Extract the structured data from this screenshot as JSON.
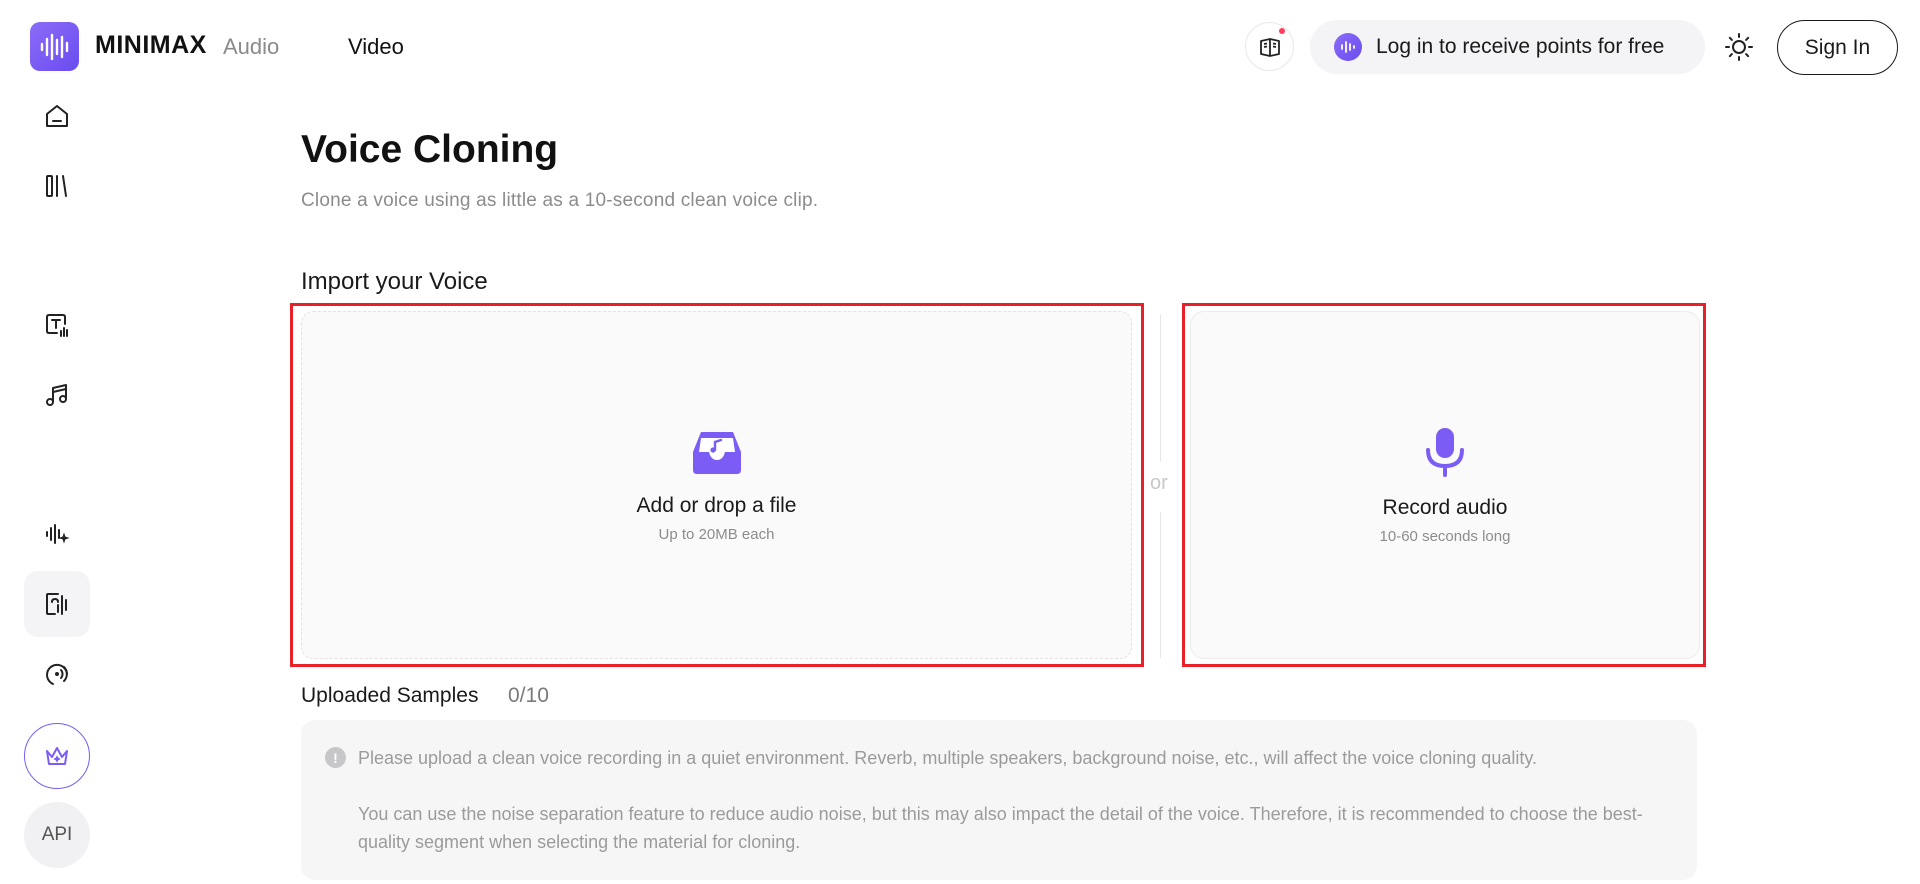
{
  "header": {
    "brand": "MINIMAX",
    "nav": {
      "audio": "Audio",
      "video": "Video"
    },
    "points_cta": "Log in to receive points for free",
    "sign_in": "Sign In",
    "icons": {
      "logo": "waveform-logo-icon",
      "guide": "book-icon",
      "theme": "sun-icon"
    }
  },
  "sidebar": {
    "items": [
      {
        "name": "home",
        "icon": "home-icon"
      },
      {
        "name": "library",
        "icon": "library-icon"
      },
      {
        "name": "text-to-speech",
        "icon": "text-speech-icon"
      },
      {
        "name": "music",
        "icon": "music-icon"
      },
      {
        "name": "voice-design",
        "icon": "sparkle-wave-icon"
      },
      {
        "name": "voice-cloning",
        "icon": "voice-clone-icon",
        "active": true
      },
      {
        "name": "voice-isolation",
        "icon": "broadcast-icon"
      },
      {
        "name": "subscription",
        "icon": "crown-icon"
      }
    ],
    "api_label": "API"
  },
  "main": {
    "title": "Voice Cloning",
    "subtitle": "Clone a voice using as little as a 10-second clean voice clip.",
    "import_label": "Import your Voice",
    "upload": {
      "title": "Add or drop a file",
      "subtitle": "Up to 20MB each",
      "icon": "inbox-music-icon"
    },
    "divider": "or",
    "record": {
      "title": "Record audio",
      "subtitle": "10-60 seconds long",
      "icon": "microphone-icon"
    },
    "uploaded": {
      "label": "Uploaded Samples",
      "count": "0/10"
    },
    "notice": {
      "line1": "Please upload a clean voice recording in a quiet environment. Reverb, multiple speakers, background noise, etc., will affect the voice cloning quality.",
      "line2": "You can use the noise separation feature to reduce audio noise, but this may also impact the detail of the voice. Therefore, it is recommended to choose the best-quality segment when selecting the material for cloning."
    }
  },
  "colors": {
    "accent": "#7b5cf4",
    "highlight": "#e8202a",
    "muted_text": "#8c8c8c"
  }
}
